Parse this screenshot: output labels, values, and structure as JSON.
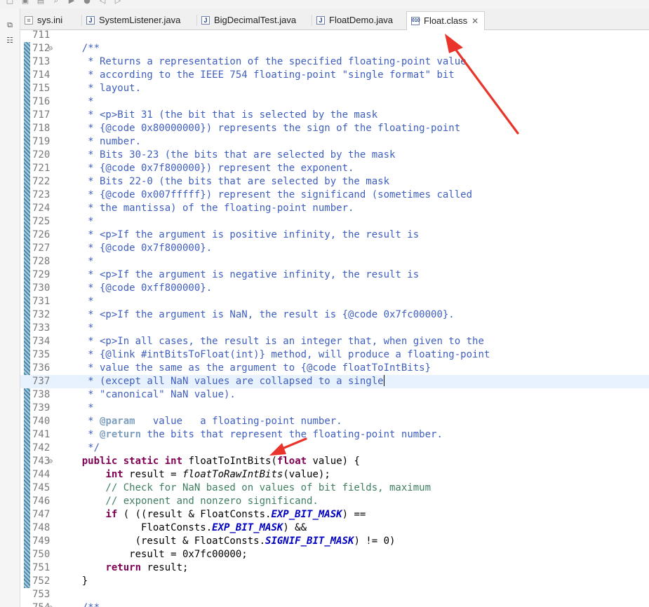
{
  "toolbar": {
    "icons": [
      "new-icon",
      "save-icon",
      "print-icon",
      "search-icon",
      "run-icon",
      "debug-icon",
      "back-icon",
      "forward-icon"
    ]
  },
  "left_panel": {
    "icons": [
      "restore-icon",
      "outline-icon"
    ]
  },
  "tabs": [
    {
      "label": "sys.ini",
      "icon": "ini-file-icon",
      "active": false
    },
    {
      "label": "SystemListener.java",
      "icon": "java-file-icon",
      "active": false
    },
    {
      "label": "BigDecimalTest.java",
      "icon": "java-file-icon",
      "active": false
    },
    {
      "label": "FloatDemo.java",
      "icon": "java-file-icon",
      "active": false
    },
    {
      "label": "Float.class",
      "icon": "class-file-icon",
      "active": true
    }
  ],
  "editor": {
    "current_line": "737",
    "lines": [
      {
        "n": "711",
        "fold": "",
        "t": [
          {
            "s": "",
            "c": ""
          }
        ]
      },
      {
        "n": "712",
        "fold": "⊖",
        "t": [
          {
            "s": "    /**",
            "c": "comment"
          }
        ]
      },
      {
        "n": "713",
        "fold": "",
        "t": [
          {
            "s": "     * Returns a representation of the specified floating-point value",
            "c": "comment"
          }
        ]
      },
      {
        "n": "714",
        "fold": "",
        "t": [
          {
            "s": "     * according to the IEEE 754 floating-point \"single format\" bit",
            "c": "comment"
          }
        ]
      },
      {
        "n": "715",
        "fold": "",
        "t": [
          {
            "s": "     * layout.",
            "c": "comment"
          }
        ]
      },
      {
        "n": "716",
        "fold": "",
        "t": [
          {
            "s": "     *",
            "c": "comment"
          }
        ]
      },
      {
        "n": "717",
        "fold": "",
        "t": [
          {
            "s": "     * <p>Bit 31 (the bit that is selected by the mask",
            "c": "comment"
          }
        ]
      },
      {
        "n": "718",
        "fold": "",
        "t": [
          {
            "s": "     * {@code 0x80000000}) represents the sign of the floating-point",
            "c": "comment"
          }
        ]
      },
      {
        "n": "719",
        "fold": "",
        "t": [
          {
            "s": "     * number.",
            "c": "comment"
          }
        ]
      },
      {
        "n": "720",
        "fold": "",
        "t": [
          {
            "s": "     * Bits 30-23 (the bits that are selected by the mask",
            "c": "comment"
          }
        ]
      },
      {
        "n": "721",
        "fold": "",
        "t": [
          {
            "s": "     * {@code 0x7f800000}) represent the exponent.",
            "c": "comment"
          }
        ]
      },
      {
        "n": "722",
        "fold": "",
        "t": [
          {
            "s": "     * Bits 22-0 (the bits that are selected by the mask",
            "c": "comment"
          }
        ]
      },
      {
        "n": "723",
        "fold": "",
        "t": [
          {
            "s": "     * {@code 0x007fffff}) represent the significand (sometimes called",
            "c": "comment"
          }
        ]
      },
      {
        "n": "724",
        "fold": "",
        "t": [
          {
            "s": "     * the mantissa) of the floating-point number.",
            "c": "comment"
          }
        ]
      },
      {
        "n": "725",
        "fold": "",
        "t": [
          {
            "s": "     *",
            "c": "comment"
          }
        ]
      },
      {
        "n": "726",
        "fold": "",
        "t": [
          {
            "s": "     * <p>If the argument is positive infinity, the result is",
            "c": "comment"
          }
        ]
      },
      {
        "n": "727",
        "fold": "",
        "t": [
          {
            "s": "     * {@code 0x7f800000}.",
            "c": "comment"
          }
        ]
      },
      {
        "n": "728",
        "fold": "",
        "t": [
          {
            "s": "     *",
            "c": "comment"
          }
        ]
      },
      {
        "n": "729",
        "fold": "",
        "t": [
          {
            "s": "     * <p>If the argument is negative infinity, the result is",
            "c": "comment"
          }
        ]
      },
      {
        "n": "730",
        "fold": "",
        "t": [
          {
            "s": "     * {@code 0xff800000}.",
            "c": "comment"
          }
        ]
      },
      {
        "n": "731",
        "fold": "",
        "t": [
          {
            "s": "     *",
            "c": "comment"
          }
        ]
      },
      {
        "n": "732",
        "fold": "",
        "t": [
          {
            "s": "     * <p>If the argument is NaN, the result is {@code 0x7fc00000}.",
            "c": "comment"
          }
        ]
      },
      {
        "n": "733",
        "fold": "",
        "t": [
          {
            "s": "     *",
            "c": "comment"
          }
        ]
      },
      {
        "n": "734",
        "fold": "",
        "t": [
          {
            "s": "     * <p>In all cases, the result is an integer that, when given to the",
            "c": "comment"
          }
        ]
      },
      {
        "n": "735",
        "fold": "",
        "t": [
          {
            "s": "     * {@link #intBitsToFloat(int)} method, will produce a floating-point",
            "c": "comment"
          }
        ]
      },
      {
        "n": "736",
        "fold": "",
        "t": [
          {
            "s": "     * value the same as the argument to {@code floatToIntBits}",
            "c": "comment"
          }
        ]
      },
      {
        "n": "737",
        "fold": "",
        "t": [
          {
            "s": "     * (except all NaN values are collapsed to a single",
            "c": "comment"
          }
        ],
        "caret": true
      },
      {
        "n": "738",
        "fold": "",
        "t": [
          {
            "s": "     * \"canonical\" NaN value).",
            "c": "comment"
          }
        ]
      },
      {
        "n": "739",
        "fold": "",
        "t": [
          {
            "s": "     *",
            "c": "comment"
          }
        ]
      },
      {
        "n": "740",
        "fold": "",
        "t": [
          {
            "s": "     * ",
            "c": "comment"
          },
          {
            "s": "@param",
            "c": "tag"
          },
          {
            "s": "   value   a floating-point number.",
            "c": "comment"
          }
        ]
      },
      {
        "n": "741",
        "fold": "",
        "t": [
          {
            "s": "     * ",
            "c": "comment"
          },
          {
            "s": "@return",
            "c": "tag"
          },
          {
            "s": " the bits that represent the floating-point number.",
            "c": "comment"
          }
        ]
      },
      {
        "n": "742",
        "fold": "",
        "t": [
          {
            "s": "     */",
            "c": "comment"
          }
        ]
      },
      {
        "n": "743",
        "fold": "⊖",
        "t": [
          {
            "s": "    ",
            "c": ""
          },
          {
            "s": "public",
            "c": "kw"
          },
          {
            "s": " ",
            "c": ""
          },
          {
            "s": "static",
            "c": "kw"
          },
          {
            "s": " ",
            "c": ""
          },
          {
            "s": "int",
            "c": "kw"
          },
          {
            "s": " floatToIntBits(",
            "c": ""
          },
          {
            "s": "float",
            "c": "kw"
          },
          {
            "s": " value) {",
            "c": ""
          }
        ]
      },
      {
        "n": "744",
        "fold": "",
        "t": [
          {
            "s": "        ",
            "c": ""
          },
          {
            "s": "int",
            "c": "kw"
          },
          {
            "s": " result = ",
            "c": ""
          },
          {
            "s": "floatToRawIntBits",
            "c": "italic"
          },
          {
            "s": "(value);",
            "c": ""
          }
        ]
      },
      {
        "n": "745",
        "fold": "",
        "t": [
          {
            "s": "        // Check for NaN based on values of bit fields, maximum",
            "c": "lcomment"
          }
        ]
      },
      {
        "n": "746",
        "fold": "",
        "t": [
          {
            "s": "        // exponent and nonzero significand.",
            "c": "lcomment"
          }
        ]
      },
      {
        "n": "747",
        "fold": "",
        "t": [
          {
            "s": "        ",
            "c": ""
          },
          {
            "s": "if",
            "c": "kw"
          },
          {
            "s": " ( ((result & FloatConsts.",
            "c": ""
          },
          {
            "s": "EXP_BIT_MASK",
            "c": "const"
          },
          {
            "s": ") ==",
            "c": ""
          }
        ]
      },
      {
        "n": "748",
        "fold": "",
        "t": [
          {
            "s": "              FloatConsts.",
            "c": ""
          },
          {
            "s": "EXP_BIT_MASK",
            "c": "const"
          },
          {
            "s": ") &&",
            "c": ""
          }
        ]
      },
      {
        "n": "749",
        "fold": "",
        "t": [
          {
            "s": "             (result & FloatConsts.",
            "c": ""
          },
          {
            "s": "SIGNIF_BIT_MASK",
            "c": "const"
          },
          {
            "s": ") != 0)",
            "c": ""
          }
        ]
      },
      {
        "n": "750",
        "fold": "",
        "t": [
          {
            "s": "            result = 0x7fc00000;",
            "c": ""
          }
        ]
      },
      {
        "n": "751",
        "fold": "",
        "t": [
          {
            "s": "        ",
            "c": ""
          },
          {
            "s": "return",
            "c": "kw"
          },
          {
            "s": " result;",
            "c": ""
          }
        ]
      },
      {
        "n": "752",
        "fold": "",
        "t": [
          {
            "s": "    }",
            "c": ""
          }
        ]
      },
      {
        "n": "753",
        "fold": "",
        "t": [
          {
            "s": "",
            "c": ""
          }
        ]
      },
      {
        "n": "754",
        "fold": "⊖",
        "t": [
          {
            "s": "    /**",
            "c": "comment"
          }
        ]
      }
    ]
  },
  "colors": {
    "annotation": "#e8342a",
    "current_line_bg": "#e8f2fe",
    "keyword": "#7f0055",
    "javadoc": "#3f5fbf",
    "line_comment": "#3f7f5f"
  }
}
